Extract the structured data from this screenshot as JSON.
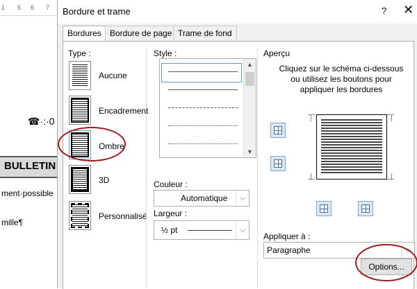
{
  "document": {
    "ruler_marks": [
      "1",
      "5",
      "6",
      "7"
    ],
    "phone_line": "☎·:·0",
    "bulletin_text": "BULLETIN",
    "line1": "ment·possible",
    "line2": "mille¶"
  },
  "dialog": {
    "title": "Bordure et trame",
    "help_label": "?",
    "close_label": "✕",
    "tabs": [
      {
        "label": "Bordures"
      },
      {
        "label": "Bordure de page"
      },
      {
        "label": "Trame de fond"
      }
    ],
    "type_section": {
      "label": "Type :",
      "options": [
        {
          "label": "Aucune"
        },
        {
          "label": "Encadrement"
        },
        {
          "label": "Ombre"
        },
        {
          "label": "3D"
        },
        {
          "label": "Personnalisé"
        }
      ]
    },
    "style_section": {
      "label": "Style :",
      "color_label": "Couleur :",
      "color_value": "Automatique",
      "width_label": "Largeur :",
      "width_value": "½ pt"
    },
    "preview_section": {
      "label": "Aperçu",
      "instructions": [
        "Cliquez sur le schéma ci-dessous",
        "ou utilisez les boutons pour",
        "appliquer les bordures"
      ],
      "apply_label": "Appliquer à :",
      "apply_value": "Paragraphe",
      "options_button": "Options..."
    },
    "colors": {
      "annotation": "#9b1c1c",
      "focus": "#5b9bd5"
    }
  }
}
